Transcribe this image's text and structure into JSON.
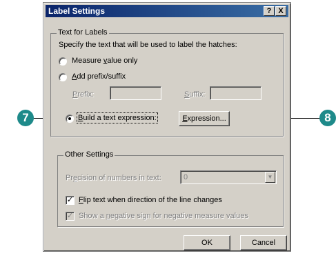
{
  "dialog": {
    "title": "Label Settings",
    "help_label": "?",
    "close_label": "X"
  },
  "text_for_labels": {
    "legend": "Text for Labels",
    "instructions": "Specify the text that will be used to label the hatches:",
    "options": [
      {
        "pre": "Measure ",
        "u": "v",
        "post": "alue only",
        "selected": false
      },
      {
        "pre": "",
        "u": "A",
        "post": "dd prefix/suffix",
        "selected": false
      },
      {
        "pre": "",
        "u": "B",
        "post": "uild a text expression:",
        "selected": true
      }
    ],
    "prefix_label": {
      "pre": "",
      "u": "P",
      "post": "refix:"
    },
    "prefix_value": "",
    "suffix_label": {
      "pre": "",
      "u": "S",
      "post": "uffix:"
    },
    "suffix_value": "",
    "expression_button": {
      "pre": "",
      "u": "E",
      "post": "xpression..."
    }
  },
  "other_settings": {
    "legend": "Other Settings",
    "precision_label": {
      "pre": "Pr",
      "u": "e",
      "post": "cision of numbers in text:"
    },
    "precision_value": "0",
    "flip_text": {
      "pre": "",
      "u": "F",
      "post": "lip text when direction of the line changes",
      "checked": true
    },
    "negative_sign": {
      "pre": "Show a ",
      "u": "n",
      "post": "egative sign for negative measure values",
      "checked": true,
      "enabled": false
    }
  },
  "buttons": {
    "ok": "OK",
    "cancel": "Cancel"
  },
  "callouts": {
    "left": "7",
    "right": "8",
    "color": "#1e8a8a"
  }
}
